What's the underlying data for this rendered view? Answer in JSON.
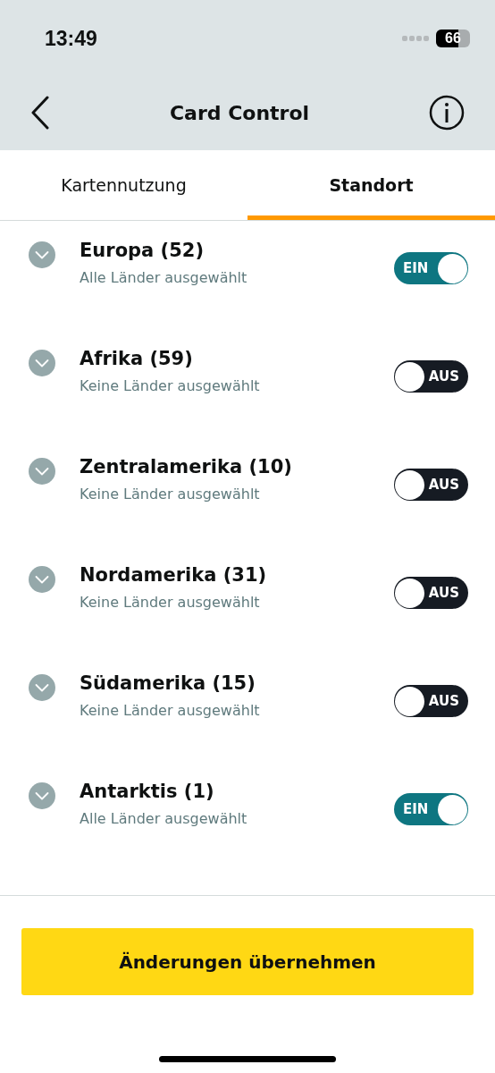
{
  "status_bar": {
    "time": "13:49",
    "battery": "66"
  },
  "header": {
    "title": "Card Control"
  },
  "tabs": [
    {
      "label": "Kartennutzung",
      "selected": false
    },
    {
      "label": "Standort",
      "selected": true
    }
  ],
  "regions": [
    {
      "name": "Europa (52)",
      "detail": "Alle Länder ausgewählt",
      "on": true,
      "toggle_label": "EIN"
    },
    {
      "name": "Afrika (59)",
      "detail": "Keine Länder ausgewählt",
      "on": false,
      "toggle_label": "AUS"
    },
    {
      "name": "Zentralamerika (10)",
      "detail": "Keine Länder ausgewählt",
      "on": false,
      "toggle_label": "AUS"
    },
    {
      "name": "Nordamerika (31)",
      "detail": "Keine Länder ausgewählt",
      "on": false,
      "toggle_label": "AUS"
    },
    {
      "name": "Südamerika (15)",
      "detail": "Keine Länder ausgewählt",
      "on": false,
      "toggle_label": "AUS"
    },
    {
      "name": "Antarktis (1)",
      "detail": "Alle Länder ausgewählt",
      "on": true,
      "toggle_label": "EIN"
    }
  ],
  "apply_button": "Änderungen übernehmen"
}
